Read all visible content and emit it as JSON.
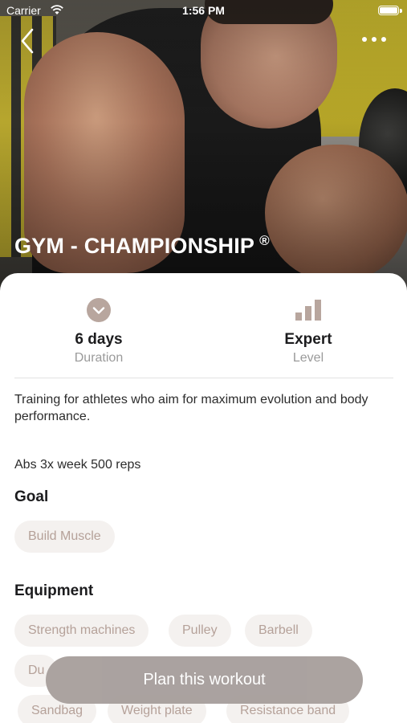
{
  "status_bar": {
    "carrier": "Carrier",
    "time": "1:56 PM"
  },
  "hero": {
    "title": "GYM - CHAMPIONSHIP",
    "trademark": "®"
  },
  "stats": {
    "duration": {
      "value": "6 days",
      "label": "Duration",
      "icon": "chevron-down-circle-icon"
    },
    "level": {
      "value": "Expert",
      "label": "Level",
      "icon": "bar-chart-icon"
    }
  },
  "description": "Training for athletes who aim for maximum evolution and body performance.",
  "note": "Abs 3x week 500 reps",
  "goal": {
    "title": "Goal",
    "chips": [
      "Build Muscle"
    ]
  },
  "equipment": {
    "title": "Equipment",
    "chips": [
      "Strength machines",
      "Pulley",
      "Barbell",
      "Du",
      "Sandbag",
      "Weight plate",
      "Resistance band"
    ]
  },
  "cta": {
    "label": "Plan this workout"
  },
  "colors": {
    "accent": "#b8a69e",
    "chip_bg": "#f4f1ef",
    "chip_text": "#b5a199",
    "button_bg": "#a8a09d"
  }
}
